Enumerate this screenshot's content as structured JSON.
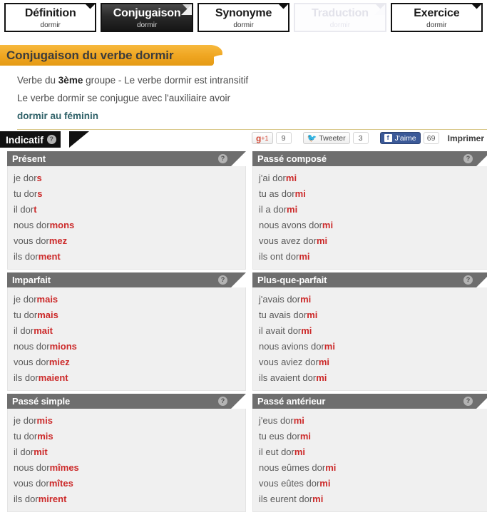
{
  "tabs": [
    {
      "label": "Définition",
      "sub": "dormir",
      "state": "normal"
    },
    {
      "label": "Conjugaison",
      "sub": "dormir",
      "state": "active"
    },
    {
      "label": "Synonyme",
      "sub": "dormir",
      "state": "normal"
    },
    {
      "label": "Traduction",
      "sub": "dormir",
      "state": "disabled"
    },
    {
      "label": "Exercice",
      "sub": "dormir",
      "state": "normal"
    }
  ],
  "banner": {
    "title": "Conjugaison du verbe dormir"
  },
  "intro": {
    "line1_prefix": "Verbe du ",
    "line1_bold": "3ème",
    "line1_suffix": " groupe - Le verbe dormir est intransitif",
    "line2": "Le verbe dormir se conjugue avec l'auxiliaire avoir",
    "feminine_link": "dormir au féminin"
  },
  "mode": {
    "label": "Indicatif",
    "help": "?"
  },
  "social": {
    "gplus": {
      "g": "g",
      "plus": "+1",
      "count": "9"
    },
    "twitter": {
      "label": "Tweeter",
      "count": "3",
      "icon": "twitter-bird-icon"
    },
    "facebook": {
      "f": "f",
      "label": "J'aime",
      "count": "69"
    },
    "print": "Imprimer"
  },
  "colors": {
    "accent_orange": "#efa520",
    "ending_red": "#cc2a2a",
    "header_gray": "#6e6e6e",
    "body_gray": "#f0f0f0",
    "link_teal": "#2f6168",
    "facebook_blue": "#3b5998"
  },
  "tenses": [
    {
      "name": "Présent",
      "help": "?",
      "rows": [
        {
          "stem": "je dor",
          "end": "s"
        },
        {
          "stem": "tu dor",
          "end": "s"
        },
        {
          "stem": "il dor",
          "end": "t"
        },
        {
          "stem": "nous dor",
          "end": "mons"
        },
        {
          "stem": "vous dor",
          "end": "mez"
        },
        {
          "stem": "ils dor",
          "end": "ment"
        }
      ]
    },
    {
      "name": "Passé composé",
      "help": "?",
      "rows": [
        {
          "stem": "j'ai dor",
          "end": "mi"
        },
        {
          "stem": "tu as dor",
          "end": "mi"
        },
        {
          "stem": "il a dor",
          "end": "mi"
        },
        {
          "stem": "nous avons dor",
          "end": "mi"
        },
        {
          "stem": "vous avez dor",
          "end": "mi"
        },
        {
          "stem": "ils ont dor",
          "end": "mi"
        }
      ]
    },
    {
      "name": "Imparfait",
      "help": "?",
      "rows": [
        {
          "stem": "je dor",
          "end": "mais"
        },
        {
          "stem": "tu dor",
          "end": "mais"
        },
        {
          "stem": "il dor",
          "end": "mait"
        },
        {
          "stem": "nous dor",
          "end": "mions"
        },
        {
          "stem": "vous dor",
          "end": "miez"
        },
        {
          "stem": "ils dor",
          "end": "maient"
        }
      ]
    },
    {
      "name": "Plus-que-parfait",
      "help": "?",
      "rows": [
        {
          "stem": "j'avais dor",
          "end": "mi"
        },
        {
          "stem": "tu avais dor",
          "end": "mi"
        },
        {
          "stem": "il avait dor",
          "end": "mi"
        },
        {
          "stem": "nous avions dor",
          "end": "mi"
        },
        {
          "stem": "vous aviez dor",
          "end": "mi"
        },
        {
          "stem": "ils avaient dor",
          "end": "mi"
        }
      ]
    },
    {
      "name": "Passé simple",
      "help": "?",
      "rows": [
        {
          "stem": "je dor",
          "end": "mis"
        },
        {
          "stem": "tu dor",
          "end": "mis"
        },
        {
          "stem": "il dor",
          "end": "mit"
        },
        {
          "stem": "nous dor",
          "end": "mîmes"
        },
        {
          "stem": "vous dor",
          "end": "mîtes"
        },
        {
          "stem": "ils dor",
          "end": "mirent"
        }
      ]
    },
    {
      "name": "Passé antérieur",
      "help": "?",
      "rows": [
        {
          "stem": "j'eus dor",
          "end": "mi"
        },
        {
          "stem": "tu eus dor",
          "end": "mi"
        },
        {
          "stem": "il eut dor",
          "end": "mi"
        },
        {
          "stem": "nous eûmes dor",
          "end": "mi"
        },
        {
          "stem": "vous eûtes dor",
          "end": "mi"
        },
        {
          "stem": "ils eurent dor",
          "end": "mi"
        }
      ]
    }
  ]
}
